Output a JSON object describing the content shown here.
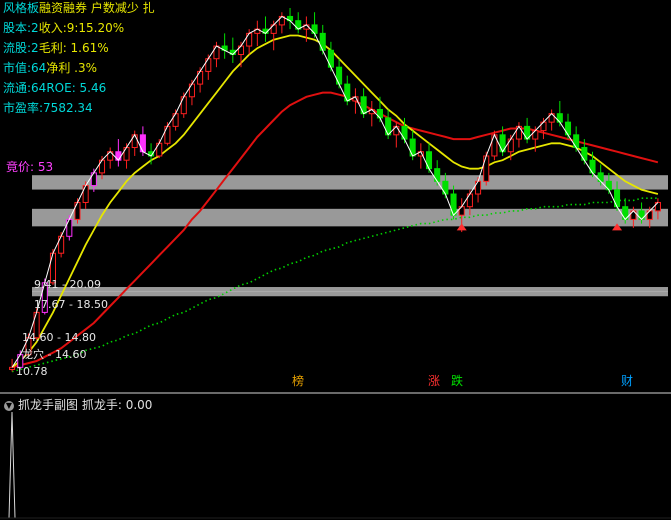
{
  "info_panel": {
    "rows": [
      {
        "label": "风格板",
        "value": "融资融券 户数减少 扎",
        "label_color": "#00d8d8",
        "value_color": "#e6e600"
      },
      {
        "label": "股本:2",
        "value": "收入:9:15.20%",
        "label_color": "#00d8d8",
        "value_color": "#e6e600"
      },
      {
        "label": "流股:2",
        "value": "毛利: 1.61%",
        "label_color": "#00d8d8",
        "value_color": "#e6e600"
      },
      {
        "label": "市值:64",
        "value": "净利 .3%",
        "label_color": "#00d8d8",
        "value_color": "#e6e600"
      },
      {
        "label": "流通:64",
        "value": "ROE: 5.46",
        "label_color": "#00d8d8",
        "value_color": "#00d8d8"
      },
      {
        "label": "市盈率:",
        "value": "7582.34",
        "label_color": "#00d8d8",
        "value_color": "#00d8d8"
      }
    ],
    "bid_label": "竟价:",
    "bid_value": "53"
  },
  "bands": [
    {
      "label": "9.41 - 20.09"
    },
    {
      "label": "17.67 - 18.50"
    },
    {
      "label": "14.60 - 14.80"
    },
    {
      "label": "龙穴 - 14.60"
    }
  ],
  "low_label": "10.78",
  "markers": [
    {
      "text": "榜",
      "color": "#e6a000"
    },
    {
      "text": "涨",
      "color": "#ff3030"
    },
    {
      "text": "跌",
      "color": "#00e000"
    },
    {
      "text": "财",
      "color": "#00a0ff"
    }
  ],
  "sub_panel": {
    "title": "抓龙手副图",
    "series_label": "抓龙手: 0.00"
  },
  "colors": {
    "up": "#ff2020",
    "down": "#00e000",
    "magenta": "#ff30ff",
    "ma_white": "#ffffff",
    "ma_yellow": "#e6e600",
    "ma_red": "#e01010",
    "ma_green_dotted": "#00d000",
    "band": "#b4b4b4"
  },
  "chart_data": {
    "type": "candlestick",
    "price_range": [
      10.78,
      28.0
    ],
    "candles": [
      [
        10.9,
        11.4,
        10.8,
        11.0
      ],
      [
        11.0,
        11.8,
        10.9,
        11.6
      ],
      [
        11.6,
        12.6,
        11.5,
        12.4
      ],
      [
        12.4,
        13.8,
        12.3,
        13.6
      ],
      [
        13.6,
        15.2,
        13.5,
        15.0
      ],
      [
        15.0,
        16.6,
        14.9,
        16.4
      ],
      [
        16.4,
        17.4,
        16.2,
        17.2
      ],
      [
        17.2,
        18.2,
        17.0,
        18.0
      ],
      [
        18.0,
        19.0,
        17.8,
        18.8
      ],
      [
        18.8,
        19.8,
        18.5,
        19.6
      ],
      [
        19.6,
        20.4,
        19.3,
        20.2
      ],
      [
        20.2,
        21.0,
        19.9,
        20.8
      ],
      [
        20.8,
        21.4,
        20.4,
        21.2
      ],
      [
        21.2,
        21.8,
        20.5,
        20.8
      ],
      [
        20.8,
        21.6,
        20.4,
        21.4
      ],
      [
        21.4,
        22.2,
        21.0,
        22.0
      ],
      [
        22.0,
        22.4,
        21.0,
        21.2
      ],
      [
        21.2,
        21.6,
        20.6,
        21.0
      ],
      [
        21.0,
        21.8,
        20.9,
        21.6
      ],
      [
        21.6,
        22.6,
        21.5,
        22.4
      ],
      [
        22.4,
        23.2,
        22.2,
        23.0
      ],
      [
        23.0,
        24.0,
        22.8,
        23.8
      ],
      [
        23.8,
        24.6,
        23.4,
        24.4
      ],
      [
        24.4,
        25.2,
        24.0,
        25.0
      ],
      [
        25.0,
        25.8,
        24.6,
        25.6
      ],
      [
        25.6,
        26.4,
        25.2,
        26.2
      ],
      [
        26.2,
        26.8,
        25.6,
        26.0
      ],
      [
        26.0,
        26.6,
        25.4,
        25.8
      ],
      [
        25.8,
        26.4,
        25.2,
        26.2
      ],
      [
        26.2,
        27.0,
        25.8,
        26.8
      ],
      [
        26.8,
        27.4,
        26.2,
        27.0
      ],
      [
        27.0,
        27.6,
        26.4,
        26.8
      ],
      [
        26.8,
        27.4,
        26.0,
        27.2
      ],
      [
        27.2,
        27.8,
        26.8,
        27.6
      ],
      [
        27.6,
        28.0,
        27.0,
        27.4
      ],
      [
        27.4,
        27.8,
        26.8,
        27.0
      ],
      [
        27.0,
        27.6,
        26.4,
        27.2
      ],
      [
        27.2,
        27.8,
        26.6,
        26.8
      ],
      [
        26.8,
        27.2,
        25.8,
        26.0
      ],
      [
        26.0,
        26.4,
        25.0,
        25.2
      ],
      [
        25.2,
        25.6,
        24.2,
        24.4
      ],
      [
        24.4,
        24.8,
        23.4,
        23.6
      ],
      [
        23.6,
        24.2,
        23.0,
        23.8
      ],
      [
        23.8,
        24.2,
        22.8,
        23.0
      ],
      [
        23.0,
        23.6,
        22.4,
        23.2
      ],
      [
        23.2,
        23.8,
        22.6,
        22.8
      ],
      [
        22.8,
        23.2,
        21.8,
        22.0
      ],
      [
        22.0,
        22.6,
        21.4,
        22.4
      ],
      [
        22.4,
        22.8,
        21.6,
        21.8
      ],
      [
        21.8,
        22.2,
        20.8,
        21.0
      ],
      [
        21.0,
        21.6,
        20.4,
        21.2
      ],
      [
        21.2,
        21.6,
        20.2,
        20.4
      ],
      [
        20.4,
        20.8,
        19.6,
        19.8
      ],
      [
        19.8,
        20.2,
        19.0,
        19.2
      ],
      [
        19.2,
        19.6,
        18.0,
        18.2
      ],
      [
        18.2,
        19.0,
        17.4,
        18.6
      ],
      [
        18.6,
        19.4,
        18.2,
        19.2
      ],
      [
        19.2,
        20.0,
        18.8,
        19.8
      ],
      [
        19.8,
        21.2,
        19.6,
        21.0
      ],
      [
        21.0,
        22.2,
        20.8,
        22.0
      ],
      [
        22.0,
        22.4,
        21.0,
        21.2
      ],
      [
        21.2,
        22.0,
        20.8,
        21.8
      ],
      [
        21.8,
        22.6,
        21.4,
        22.4
      ],
      [
        22.4,
        22.8,
        21.6,
        21.8
      ],
      [
        21.8,
        22.4,
        21.2,
        22.2
      ],
      [
        22.2,
        22.8,
        21.8,
        22.6
      ],
      [
        22.6,
        23.2,
        22.2,
        23.0
      ],
      [
        23.0,
        23.6,
        22.4,
        22.6
      ],
      [
        22.6,
        23.0,
        21.8,
        22.0
      ],
      [
        22.0,
        22.4,
        21.2,
        21.4
      ],
      [
        21.4,
        21.8,
        20.6,
        20.8
      ],
      [
        20.8,
        21.2,
        20.0,
        20.2
      ],
      [
        20.2,
        20.6,
        19.6,
        19.8
      ],
      [
        19.8,
        20.2,
        19.2,
        19.4
      ],
      [
        19.4,
        19.8,
        18.4,
        18.6
      ],
      [
        18.6,
        19.0,
        17.8,
        18.0
      ],
      [
        18.0,
        18.6,
        17.6,
        18.4
      ],
      [
        18.4,
        18.8,
        17.8,
        18.0
      ],
      [
        18.0,
        18.6,
        17.6,
        18.4
      ],
      [
        18.4,
        19.0,
        18.0,
        18.8
      ]
    ],
    "ma_white": [
      11.0,
      11.6,
      12.4,
      13.6,
      15.0,
      16.4,
      17.2,
      18.0,
      18.8,
      19.6,
      20.2,
      20.8,
      21.2,
      20.8,
      21.4,
      22.0,
      21.2,
      21.0,
      21.6,
      22.4,
      23.0,
      23.8,
      24.4,
      25.0,
      25.6,
      26.2,
      26.0,
      25.8,
      26.2,
      26.8,
      27.0,
      26.8,
      27.2,
      27.6,
      27.4,
      27.0,
      27.2,
      26.8,
      26.0,
      25.2,
      24.4,
      23.6,
      23.8,
      23.0,
      23.2,
      22.8,
      22.0,
      22.4,
      21.8,
      21.0,
      21.2,
      20.4,
      19.8,
      19.2,
      18.2,
      18.6,
      19.2,
      19.8,
      21.0,
      22.0,
      21.2,
      21.8,
      22.4,
      21.8,
      22.2,
      22.6,
      23.0,
      22.6,
      22.0,
      21.4,
      20.8,
      20.2,
      19.8,
      19.4,
      18.6,
      18.0,
      18.4,
      18.0,
      18.4,
      18.8
    ],
    "ma_yellow": [
      11.0,
      11.3,
      11.7,
      12.2,
      12.9,
      13.6,
      14.4,
      15.2,
      16.0,
      16.8,
      17.5,
      18.2,
      18.8,
      19.3,
      19.8,
      20.2,
      20.5,
      20.8,
      21.0,
      21.3,
      21.6,
      22.0,
      22.5,
      23.0,
      23.5,
      24.0,
      24.5,
      25.0,
      25.4,
      25.8,
      26.1,
      26.3,
      26.5,
      26.6,
      26.7,
      26.7,
      26.6,
      26.5,
      26.3,
      26.0,
      25.6,
      25.2,
      24.8,
      24.4,
      24.0,
      23.6,
      23.2,
      22.9,
      22.5,
      22.2,
      21.9,
      21.6,
      21.3,
      21.0,
      20.7,
      20.5,
      20.4,
      20.4,
      20.5,
      20.7,
      20.8,
      21.0,
      21.2,
      21.3,
      21.4,
      21.5,
      21.6,
      21.6,
      21.5,
      21.4,
      21.2,
      21.0,
      20.7,
      20.4,
      20.1,
      19.8,
      19.6,
      19.4,
      19.3,
      19.2
    ],
    "ma_red": [
      11.0,
      11.1,
      11.2,
      11.3,
      11.5,
      11.7,
      11.9,
      12.2,
      12.5,
      12.8,
      13.1,
      13.5,
      13.9,
      14.3,
      14.7,
      15.1,
      15.5,
      15.9,
      16.3,
      16.7,
      17.1,
      17.5,
      18.0,
      18.4,
      18.9,
      19.4,
      19.9,
      20.4,
      20.9,
      21.4,
      21.9,
      22.3,
      22.7,
      23.1,
      23.4,
      23.6,
      23.8,
      23.9,
      24.0,
      24.0,
      23.9,
      23.8,
      23.6,
      23.4,
      23.2,
      23.0,
      22.8,
      22.6,
      22.4,
      22.3,
      22.2,
      22.1,
      22.0,
      21.9,
      21.8,
      21.8,
      21.8,
      21.9,
      22.0,
      22.1,
      22.2,
      22.3,
      22.3,
      22.3,
      22.2,
      22.1,
      22.0,
      21.9,
      21.8,
      21.7,
      21.6,
      21.5,
      21.4,
      21.3,
      21.2,
      21.1,
      21.0,
      20.9,
      20.8,
      20.7
    ],
    "ma_green_dotted": [
      10.8,
      10.9,
      11.0,
      11.1,
      11.2,
      11.3,
      11.4,
      11.5,
      11.6,
      11.8,
      11.9,
      12.0,
      12.2,
      12.3,
      12.5,
      12.6,
      12.8,
      13.0,
      13.1,
      13.3,
      13.5,
      13.6,
      13.8,
      14.0,
      14.2,
      14.3,
      14.5,
      14.7,
      14.9,
      15.0,
      15.2,
      15.4,
      15.6,
      15.7,
      15.9,
      16.0,
      16.2,
      16.3,
      16.5,
      16.6,
      16.7,
      16.9,
      17.0,
      17.1,
      17.2,
      17.3,
      17.4,
      17.5,
      17.6,
      17.7,
      17.8,
      17.8,
      17.9,
      18.0,
      18.0,
      18.1,
      18.1,
      18.2,
      18.2,
      18.3,
      18.3,
      18.4,
      18.4,
      18.5,
      18.5,
      18.6,
      18.6,
      18.6,
      18.7,
      18.7,
      18.7,
      18.8,
      18.8,
      18.8,
      18.9,
      18.9,
      18.9,
      19.0,
      19.0,
      19.0
    ],
    "bands": [
      [
        19.41,
        20.09
      ],
      [
        17.67,
        18.5
      ],
      [
        14.6,
        14.8
      ],
      [
        14.4,
        14.6
      ]
    ],
    "sub_series": [
      0,
      0,
      0,
      0,
      0,
      0,
      0,
      0,
      0,
      0,
      0,
      0,
      0,
      0,
      0,
      0,
      0,
      0,
      0,
      0,
      0,
      0,
      0,
      0,
      0,
      0,
      0,
      0,
      0,
      0,
      0,
      0,
      0,
      0,
      0,
      0,
      0,
      0,
      0,
      0,
      0,
      0,
      0,
      0,
      0,
      0,
      0,
      0,
      0,
      0,
      0,
      0,
      0,
      0,
      0,
      0,
      0,
      0,
      0,
      0,
      0,
      0,
      0,
      0,
      0,
      0,
      0,
      0,
      0,
      0,
      0,
      0,
      0,
      0,
      0,
      0,
      0,
      0,
      0,
      0
    ],
    "sub_spike_value": 1.0
  }
}
